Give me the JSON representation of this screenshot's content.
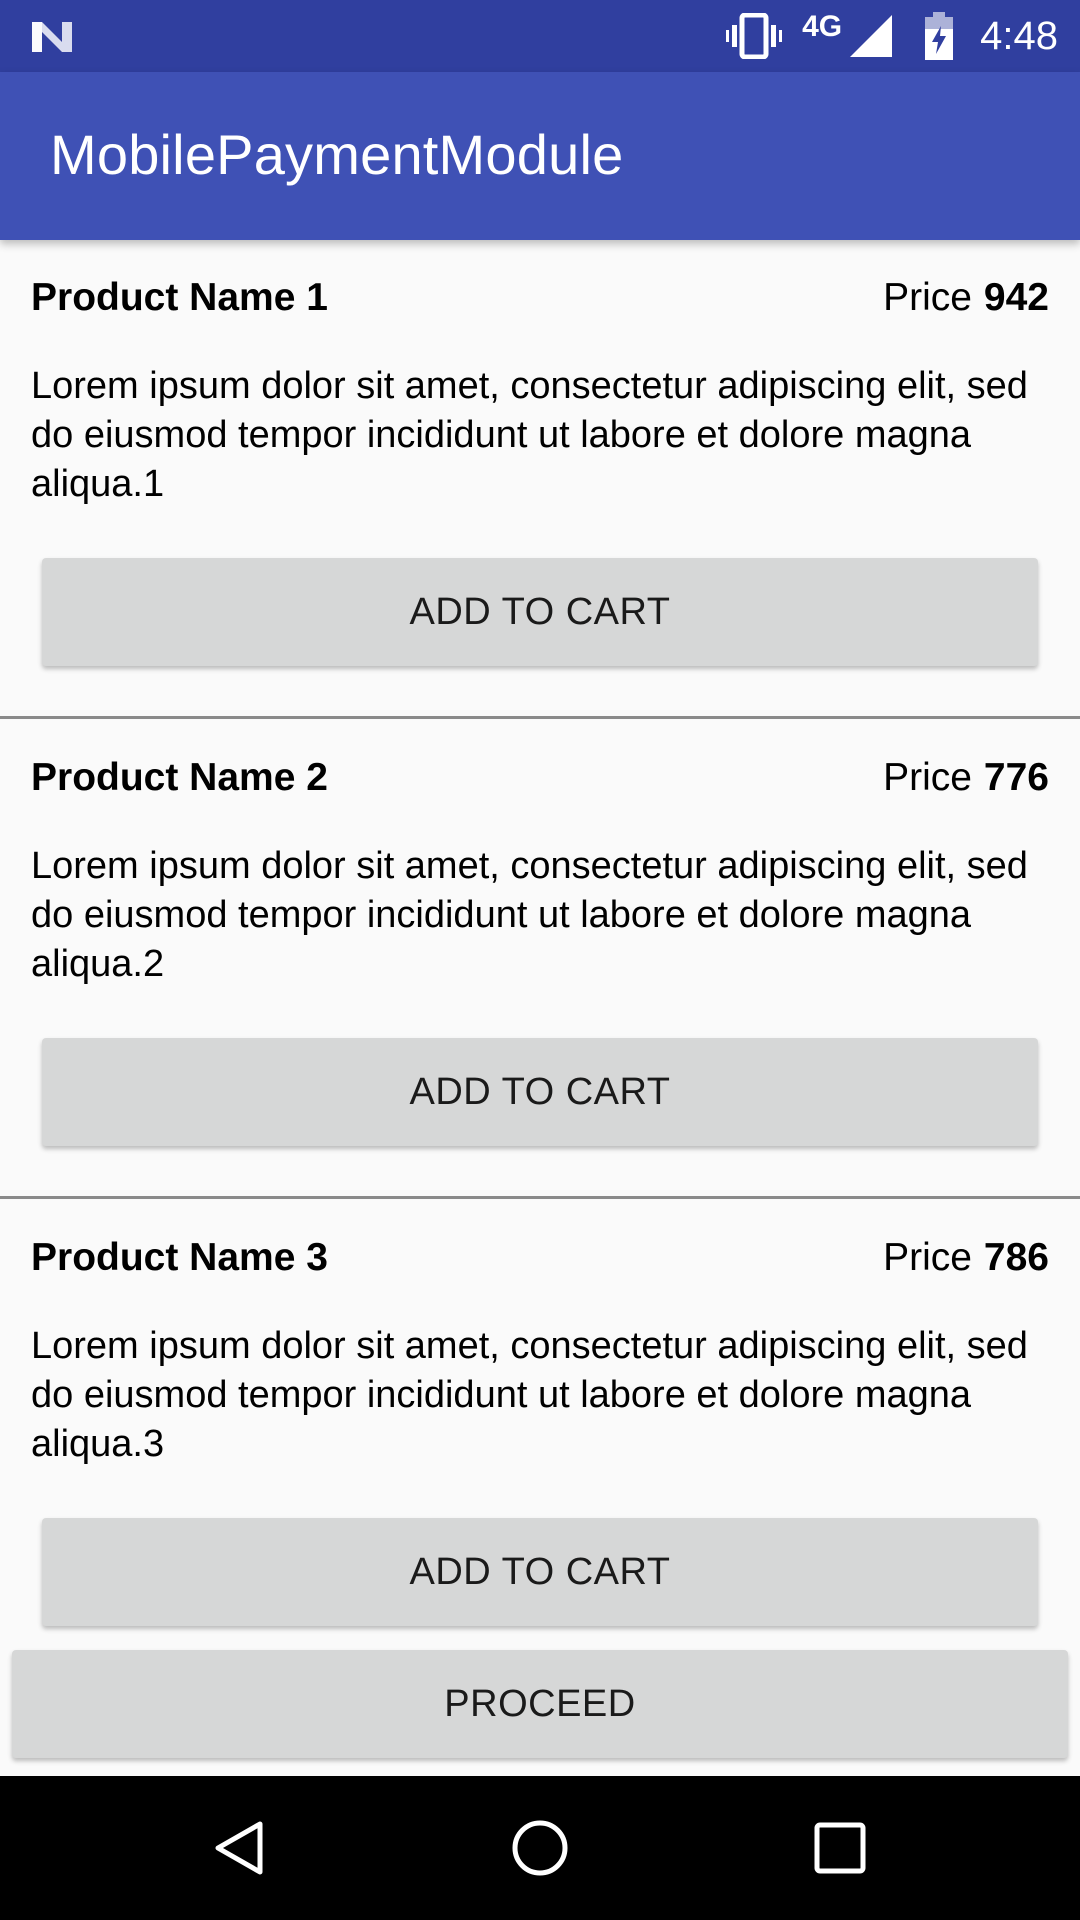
{
  "status_bar": {
    "network_label": "4G",
    "time": "4:48",
    "icons": [
      "notification-n-icon",
      "vibrate-icon",
      "signal-icon",
      "battery-charging-icon"
    ],
    "background_color": "#303F9F"
  },
  "app_bar": {
    "title": "MobilePaymentModule",
    "background_color": "#3F51B5"
  },
  "products": [
    {
      "name": "Product Name 1",
      "price_label": "Price",
      "price_value": "942",
      "description": "Lorem ipsum dolor sit amet, consectetur adipiscing elit, sed do eiusmod tempor incididunt ut labore et dolore magna aliqua.1",
      "button_label": "ADD TO CART"
    },
    {
      "name": "Product Name 2",
      "price_label": "Price",
      "price_value": "776",
      "description": "Lorem ipsum dolor sit amet, consectetur adipiscing elit, sed do eiusmod tempor incididunt ut labore et dolore magna aliqua.2",
      "button_label": "ADD TO CART"
    },
    {
      "name": "Product Name 3",
      "price_label": "Price",
      "price_value": "786",
      "description": "Lorem ipsum dolor sit amet, consectetur adipiscing elit, sed do eiusmod tempor incididunt ut labore et dolore magna aliqua.3",
      "button_label": "ADD TO CART"
    }
  ],
  "footer": {
    "proceed_label": "PROCEED"
  },
  "nav_bar": {
    "icons": [
      "back-icon",
      "home-icon",
      "recents-icon"
    ]
  }
}
